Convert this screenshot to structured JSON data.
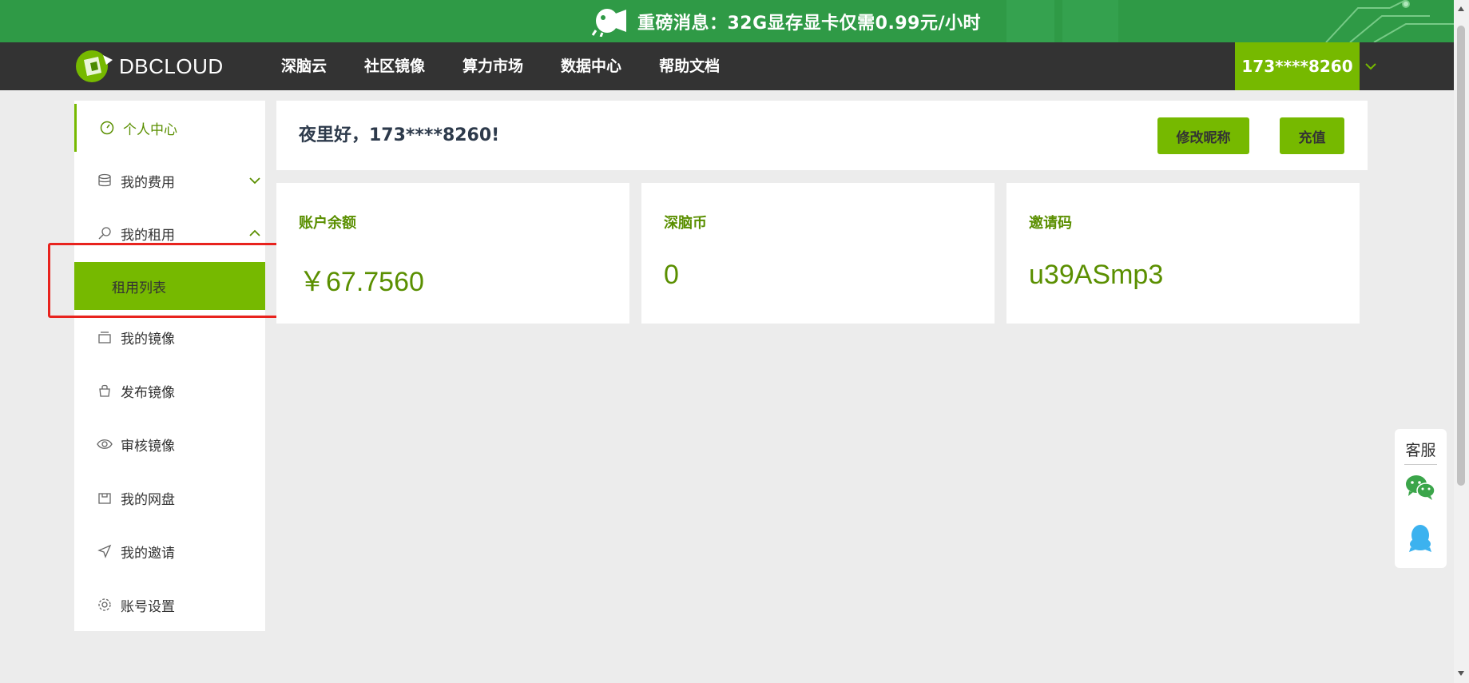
{
  "banner": {
    "text": "重磅消息：32G显存显卡仅需0.99元/小时"
  },
  "nav": {
    "logo_text": "DBCLOUD",
    "links": [
      "深脑云",
      "社区镜像",
      "算力市场",
      "数据中心",
      "帮助文档"
    ],
    "user": "173****8260"
  },
  "sidebar": {
    "items": [
      {
        "label": "个人中心",
        "icon": "dashboard-icon"
      },
      {
        "label": "我的费用",
        "icon": "database-icon"
      },
      {
        "label": "我的租用",
        "icon": "search-rent-icon"
      },
      {
        "label": "我的镜像",
        "icon": "image-stack-icon"
      },
      {
        "label": "发布镜像",
        "icon": "publish-bag-icon"
      },
      {
        "label": "审核镜像",
        "icon": "eye-icon"
      },
      {
        "label": "我的网盘",
        "icon": "netdisk-icon"
      },
      {
        "label": "我的邀请",
        "icon": "send-icon"
      },
      {
        "label": "账号设置",
        "icon": "settings-icon"
      }
    ],
    "sub_item": "租用列表"
  },
  "main": {
    "greeting": "夜里好，173****8260!",
    "edit_nickname": "修改昵称",
    "recharge": "充值",
    "stats": [
      {
        "label": "账户余额",
        "value": "￥67.7560"
      },
      {
        "label": "深脑币",
        "value": "0"
      },
      {
        "label": "邀请码",
        "value": "u39ASmp3"
      }
    ]
  },
  "service": {
    "title": "客服"
  },
  "colors": {
    "accent": "#76b900",
    "banner": "#2f9a46",
    "nav": "#333333",
    "highlight": "#e8231e"
  }
}
